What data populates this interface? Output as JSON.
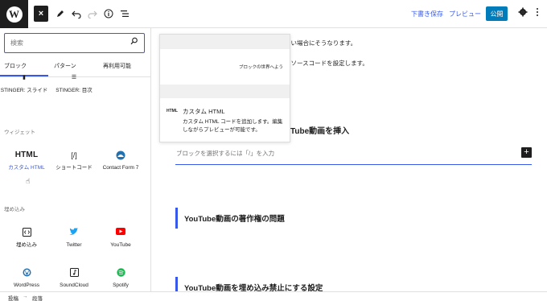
{
  "toolbar": {
    "logo_letter": "W",
    "close_icon": "×",
    "draft_label": "下書き保存",
    "preview_label": "プレビュー",
    "publish_label": "公開"
  },
  "inserter": {
    "search_placeholder": "検索",
    "tabs": [
      "ブロック",
      "パターン",
      "再利用可能"
    ],
    "top_blocks": [
      "STINGER: スライド",
      "STINGER: 目次"
    ],
    "widgets_label": "ウィジェット",
    "widgets": [
      {
        "label": "カスタム HTML",
        "icon": "html-icon",
        "badge": "HTML"
      },
      {
        "label": "ショートコード",
        "icon": "shortcode-icon",
        "glyph": "[/]"
      },
      {
        "label": "Contact Form 7",
        "icon": "contact-form-icon"
      }
    ],
    "embeds_label": "埋め込み",
    "embeds": [
      {
        "label": "埋め込み",
        "icon": "embed-icon"
      },
      {
        "label": "Twitter",
        "icon": "twitter-icon"
      },
      {
        "label": "YouTube",
        "icon": "youtube-icon"
      },
      {
        "label": "WordPress",
        "icon": "wordpress-icon"
      },
      {
        "label": "SoundCloud",
        "icon": "soundcloud-icon"
      },
      {
        "label": "Spotify",
        "icon": "spotify-icon"
      }
    ]
  },
  "preview": {
    "sample_text": "ブロックの世界へよう",
    "badge": "HTML",
    "title": "カスタム HTML",
    "description": "カスタム HTML コードを追加します。編集しながらプレビューが可能です。"
  },
  "editor": {
    "line1": "ない場合にそうなります。",
    "line2": "みソースコードを設定します。",
    "heading_partial": "Tube動画を挿入",
    "block_placeholder": "ブロックを選択するには「/」を入力",
    "heading2": "YouTube動画の著作権の問題",
    "heading3": "YouTube動画を埋め込み禁止にする設定"
  },
  "breadcrumb": {
    "item1": "投稿",
    "separator": "→",
    "item2": "段落"
  },
  "colors": {
    "accent": "#3858e9",
    "publish": "#007cba",
    "dark": "#1e1e1e"
  }
}
